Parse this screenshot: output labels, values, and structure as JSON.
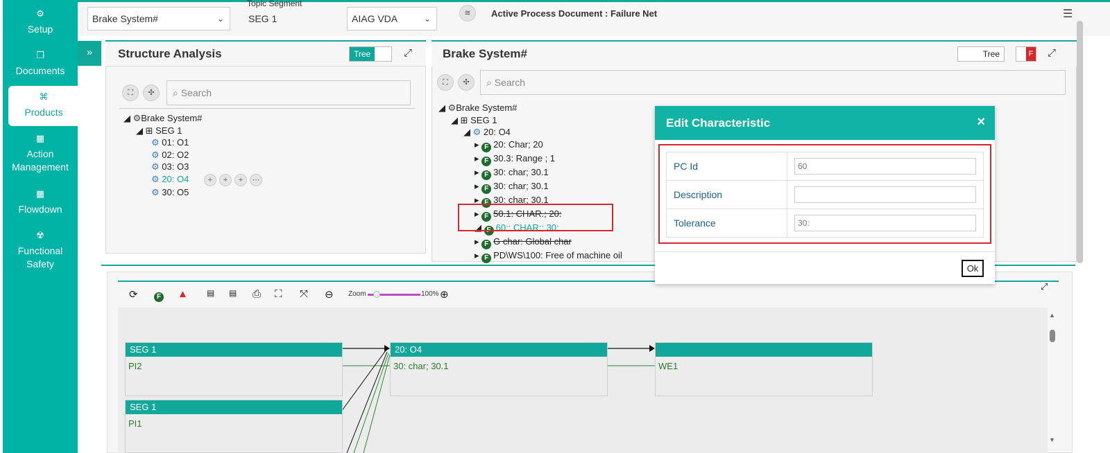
{
  "sidebar": {
    "items": [
      {
        "label": "Setup",
        "icon": "gears-icon"
      },
      {
        "label": "Documents",
        "icon": "documents-icon"
      },
      {
        "label": "Products",
        "icon": "products-icon",
        "active": true
      },
      {
        "label": "Action Management",
        "icon": "building-icon"
      },
      {
        "label": "Flowdown",
        "icon": "building-icon"
      },
      {
        "label": "Functional Safety",
        "icon": "safety-icon"
      }
    ]
  },
  "topbar": {
    "product_select": "Brake System#",
    "topic_segment_label": "Topic Segment",
    "topic_segment_value": "SEG 1",
    "standard_select": "AIAG VDA",
    "active_doc": "Active Process Document : Failure Net"
  },
  "structure": {
    "title": "Structure Analysis",
    "toggle_label": "Tree",
    "search_placeholder": "Search",
    "tree": [
      "Brake System#",
      "SEG 1",
      "01: O1",
      "02: O2",
      "03: O3",
      "20: O4",
      "30: O5"
    ]
  },
  "brake": {
    "title": "Brake System#",
    "toggle_label": "Tree",
    "flag_label": "F",
    "search_placeholder": "Search",
    "tree_root": "Brake System#",
    "tree_seg": "SEG 1",
    "tree_op": "20: O4",
    "chars": [
      "20: Char; 20",
      "30.3: Range ; 1",
      "30: char; 30.1",
      "30: char; 30.1",
      "30: char; 30.1",
      "50.1: CHAR.; 20:",
      "60:: CHAR:; 30:",
      "G char: Global char",
      "PD\\WS\\100: Free of machine oil"
    ]
  },
  "modal": {
    "title": "Edit Characteristic",
    "close": "×",
    "fields": [
      {
        "label": "PC Id",
        "value": "60"
      },
      {
        "label": "Description",
        "value": ""
      },
      {
        "label": "Tolerance",
        "value": "30:"
      }
    ],
    "ok_label": "Ok"
  },
  "diagram": {
    "zoom_label": "Zoom",
    "zoom_value": "100%",
    "nodes": [
      {
        "header": "SEG 1",
        "body": "PI2"
      },
      {
        "header": "20: O4",
        "body": "30: char; 30.1"
      },
      {
        "header": "",
        "body": "WE1"
      },
      {
        "header": "SEG 1",
        "body": "PI1"
      }
    ]
  },
  "colors": {
    "accent": "#01b2a6",
    "highlight": "#d9262a",
    "badge": "#1e6b2b"
  }
}
